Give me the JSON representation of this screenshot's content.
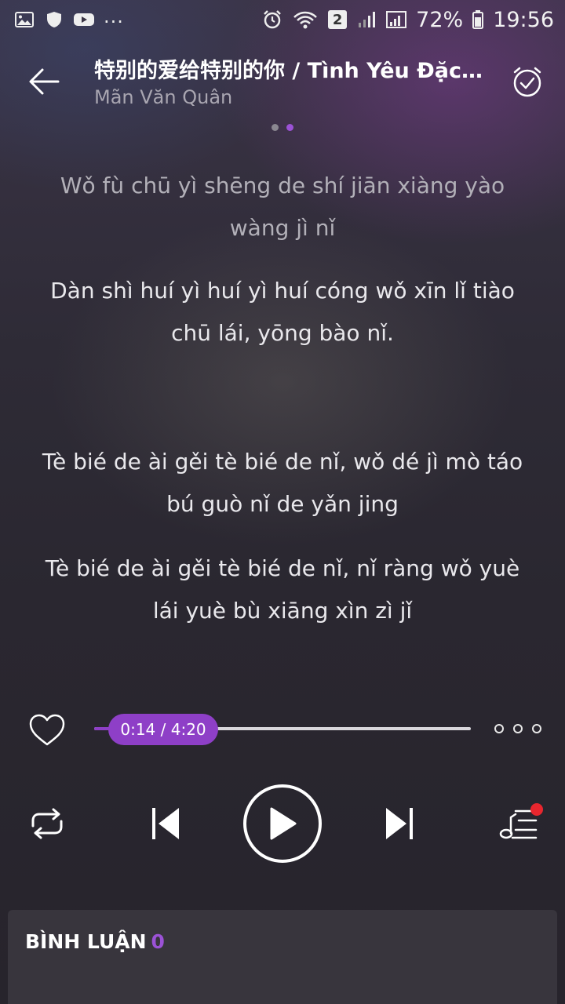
{
  "status_bar": {
    "icons_left": [
      "gallery-icon",
      "shield-icon",
      "youtube-icon"
    ],
    "more": "...",
    "sim_badge": "2",
    "battery": "72%",
    "time": "19:56"
  },
  "header": {
    "title": "特别的爱给特别的你 / Tình Yêu Đặc Biệt Dành Cho Người Đặc Biệt",
    "artist": "Mãn Văn Quân"
  },
  "pager": {
    "pages": 2,
    "active": 2
  },
  "lyrics": [
    "Wǒ fù chū yì shēng de shí jiān xiàng yào wàng jì nǐ",
    "Dàn shì huí yì huí yì huí cóng wǒ xīn lǐ tiào chū lái, yōng bào nǐ.",
    "Tè bié de ài gěi tè bié de nǐ, wǒ dé jì mò táo bú guò nǐ de yǎn jing",
    "Tè bié de ài gěi tè bié de nǐ, nǐ ràng wǒ yuè lái yuè bù xiāng xìn zì jǐ"
  ],
  "player": {
    "time_label": "0:14 / 4:20",
    "progress_fraction": 0.054,
    "accent_color": "#8e3fc7"
  },
  "comments": {
    "title": "BÌNH LUẬN",
    "count": "0"
  }
}
